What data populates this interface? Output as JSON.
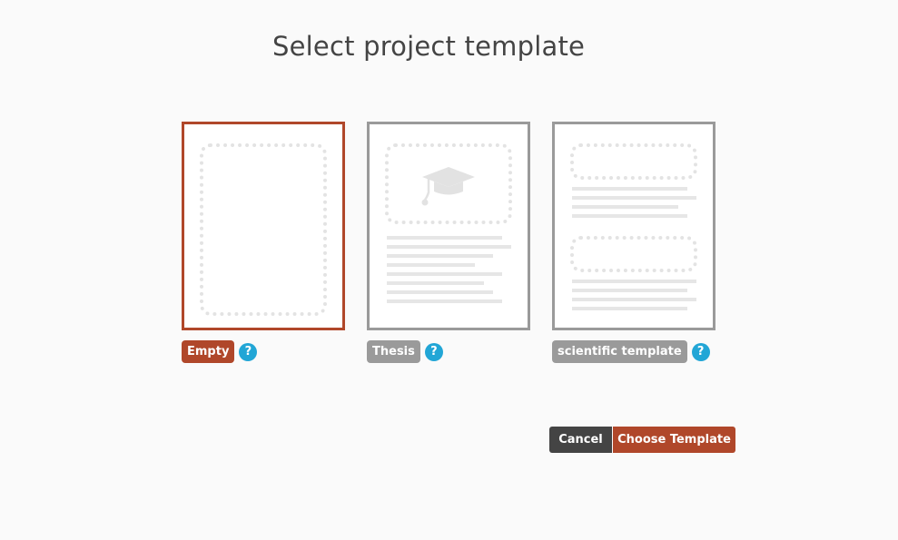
{
  "page": {
    "title": "Select project template"
  },
  "templates": [
    {
      "label": "Empty",
      "help": "?",
      "selected": true
    },
    {
      "label": "Thesis",
      "help": "?",
      "selected": false
    },
    {
      "label": "scientific template",
      "help": "?",
      "selected": false
    }
  ],
  "actions": {
    "cancel_label": "Cancel",
    "choose_label": "Choose Template"
  },
  "colors": {
    "accent": "#b0472a",
    "help": "#22a6d6",
    "card_border": "#9a9a9a",
    "cancel_bg": "#444444"
  },
  "icons": {
    "thesis_preview": "graduation-cap-icon",
    "help": "question-mark-icon"
  }
}
